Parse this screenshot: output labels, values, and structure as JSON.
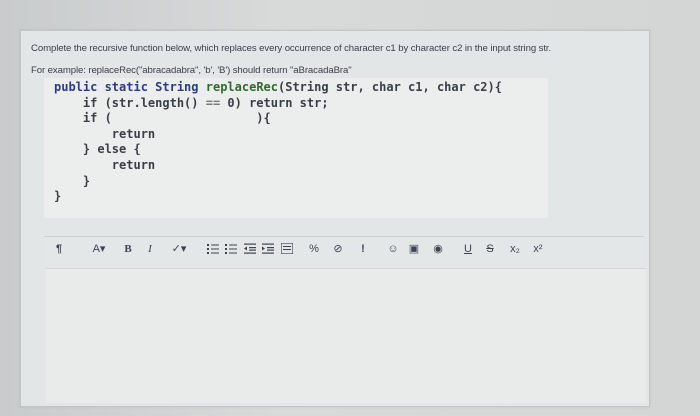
{
  "question": {
    "line1": "Complete the recursive function below, which replaces every occurrence of character c1 by character c2 in the input string str.",
    "line2": "For example: replaceRec(\"abracadabra\", 'b', 'B') should return \"aBracadaBra\""
  },
  "code": {
    "l1a": "public static ",
    "l1b": "String",
    "l1c": " replaceRec",
    "l1d": "(String str, char c1, char c2){",
    "l2a": "    if (str.length() ",
    "l2b": "==",
    "l2c": " 0) return str;",
    "l3": "    if (                    ){",
    "l4": "        return",
    "l5": "    } else {",
    "l6": "        return",
    "l7": "    }",
    "l8": "}"
  },
  "toolbar": {
    "paragraph": "¶",
    "font_color": "A▾",
    "bold": "B",
    "italic": "I",
    "highlight": "✓▾",
    "link": "%",
    "unlink": "⊘",
    "important": "!",
    "emoji": "☺",
    "image": "▣",
    "record": "◉",
    "underline": "U",
    "strike": "S",
    "subscript": "x₂",
    "superscript": "x²"
  }
}
